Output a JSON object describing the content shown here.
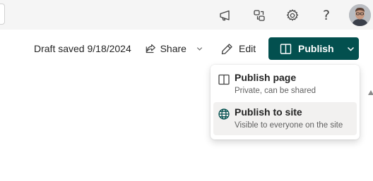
{
  "topbar": {
    "icons": [
      "megaphone-icon",
      "share-nodes-icon",
      "gear-icon",
      "help-icon"
    ],
    "help_glyph": "?"
  },
  "command_bar": {
    "draft_status": "Draft saved 9/18/2024",
    "share_label": "Share",
    "edit_label": "Edit",
    "publish_label": "Publish"
  },
  "publish_menu": {
    "items": [
      {
        "title": "Publish page",
        "description": "Private, can be shared",
        "icon": "book-open-icon"
      },
      {
        "title": "Publish to site",
        "description": "Visible to everyone on the site",
        "icon": "globe-icon"
      }
    ]
  },
  "colors": {
    "publish_button": "#03504f",
    "topbar_bg": "#f5f5f5",
    "menu_hover": "#f2f1f0"
  }
}
